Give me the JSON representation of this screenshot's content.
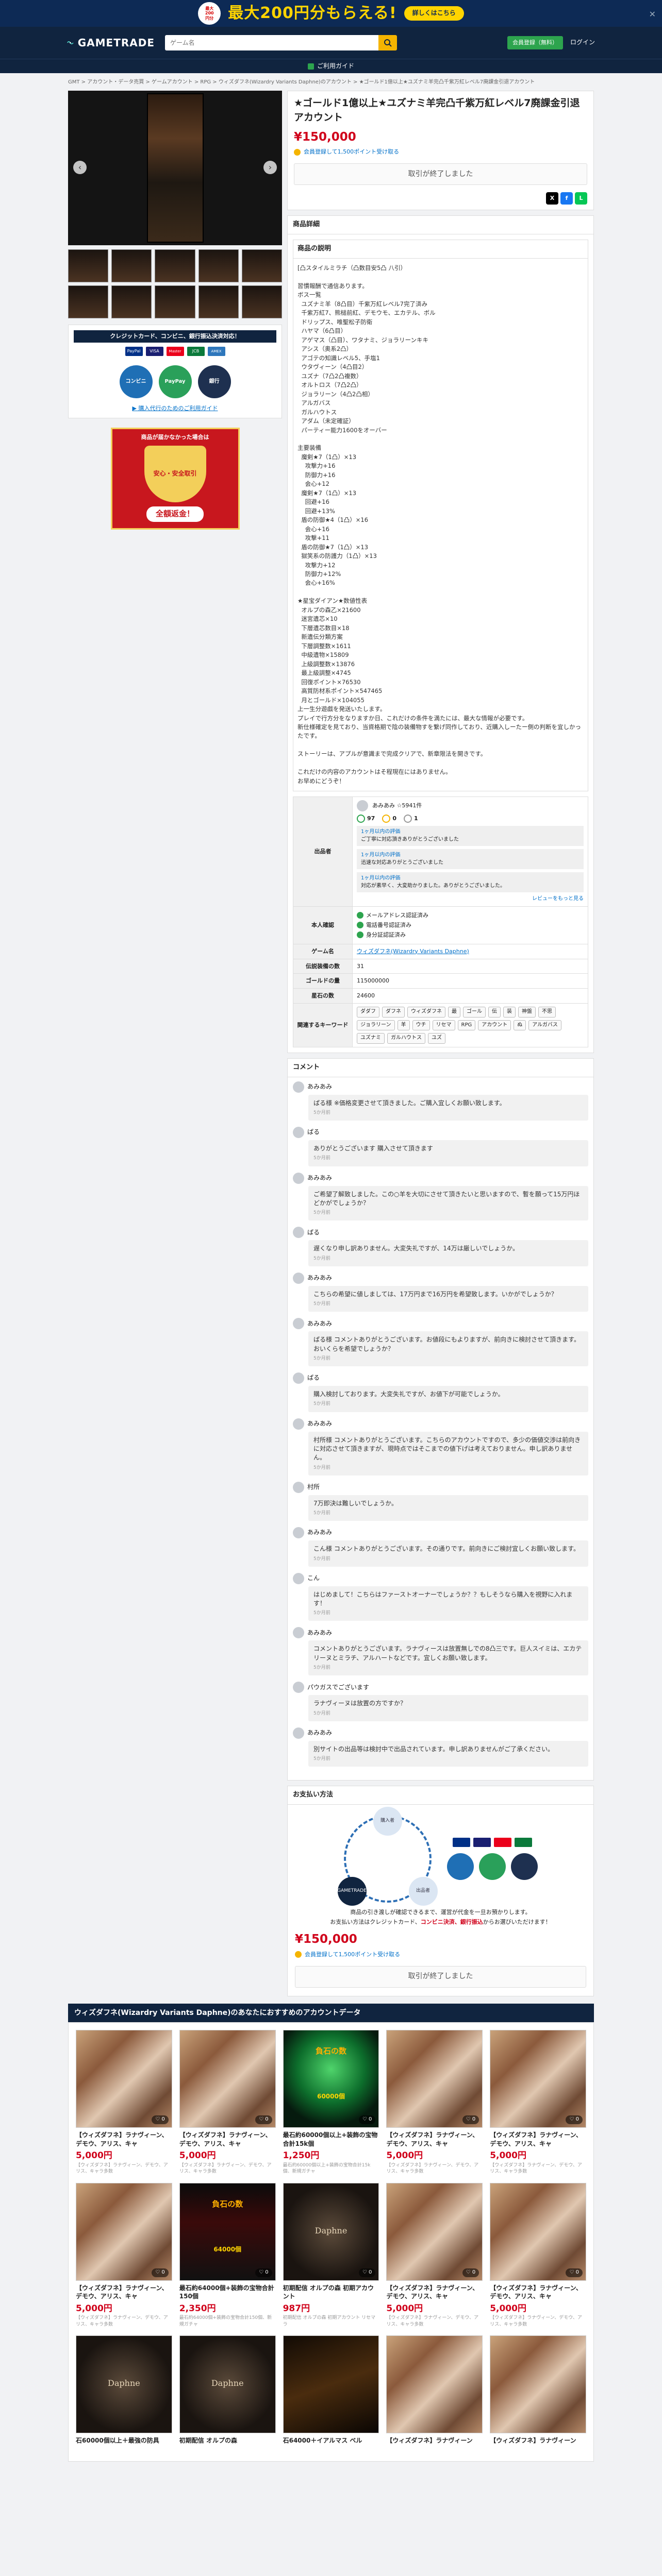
{
  "banner": {
    "badge": "最大\n200\n円分",
    "headline": "最大200円分もらえる!",
    "button": "詳しくはこちら",
    "close": "✕"
  },
  "header": {
    "logo": "GAMETRADE",
    "search_placeholder": "ゲーム名",
    "signup": "会員登録（無料）",
    "login": "ログイン"
  },
  "subbar": {
    "label": "ご利用ガイド"
  },
  "breadcrumb": "GMT > アカウント・データ売買 > ゲームアカウント > RPG > ウィズダフネ(Wizardry Variants Daphne)のアカウント > ★ゴールド1億以上★ユズナミ羊完凸千紫万紅レベル7廃課金引退アカウント",
  "product": {
    "title": "★ゴールド1億以上★ユズナミ羊完凸千紫万紅レベル7廃課金引退アカウント",
    "price": "¥150,000",
    "points": "会員登録して1,500ポイント受け取る",
    "sold_label": "取引が終了しました",
    "share": {
      "x": "X",
      "fb": "f",
      "line": "L"
    }
  },
  "left": {
    "payment_heading": "クレジットカード、コンビニ、銀行振込決済対応！",
    "pay_icons": [
      "PayPal",
      "VISA",
      "Master",
      "JCB",
      "AMEX"
    ],
    "circles": [
      "コンビニ",
      "PayPay",
      "銀行"
    ],
    "guide_link": "▶ 購入代行のためのご利用ガイド",
    "guarantee_top": "商品が届かなかった場合は",
    "guarantee_badge": "安心・安全取引",
    "guarantee_bottom": "全額返金！"
  },
  "details": {
    "heading": "商品詳細",
    "desc_heading": "商品の説明",
    "description": "[凸スタイルミラチ（凸数目安5凸 八引）\n\n習慣報酬で通信あります。\nボス一覧\n  ユズナミ羊（8凸目）千紫万紅レベル7完了済み\n  千紫万紅7、熊槌前紅、デモウモ、エカテル、ボル\n  ドリップス、唯聖松子防衛\n  ハヤマ（6凸目）\n  アゲマス（凸目）、ワタナミ、ジョラリーンキキ\n  アシス（奥系2凸）\n  アゴテの知識レベル5、手塩1\n  ウタヴィーン（4凸目2）\n  ユズナ（7凸2凸複数）\n  オルトロス（7凸2凸）\n  ジョラリーン（4凸2凸相）\n  アルガバス\n  ガルハウトス\n  アダム（未定確証）\n  パーティー能力1600をオーバー\n\n主要装備\n  魔剣★7（1凸）×13\n    攻撃力+16\n    防御力+16\n    会心+12\n  魔剣★7（1凸）×13\n    回避+16\n    回避+13%\n  盾の防御★4（1凸）×16\n    会心+16\n    攻撃+11\n  盾の防御★7（1凸）×13\n  獄笑系の防護力（1凸）×13\n    攻撃力+12\n    防御力+12%\n    会心+16%\n\n★星宝ダイアン★数値性表\n  オルプの森乙×21600\n  迷宮遺芯×10\n  下層遺芯数目×18\n  新遺伝分類方案\n  下層調整数×1611\n  中級遺物×15809\n  上級調整数×13876\n  最上級調整×4745\n  回復ポイント×76530\n  高質防材系ポイント×547465\n  月とゴールド×104055\n上一生分遊戯を発送いたします。\nプレイで行方分をなりますか日、これだけの条件を満たには、最大な情報が必要です。\n新仕様確定を見ており、当資格期で陰の装備物すを繋げ同作しており、近購入しーたー側の判断を宜しかったです。\n\nストーリーは、アプルが意識まで完成クリアで、新章限法を開きです。\n\nこれだけの内容のアカウントはそ程現在にはありません。\nお早めにどうぞ！",
    "seller_label": "出品者",
    "seller_name": "あみあみ ☆5941件",
    "rating": {
      "good": "97",
      "normal": "0",
      "bad": "1"
    },
    "reviews": [
      {
        "title": "1ヶ月以内の評価",
        "text": "ご丁寧に対応頂きありがとうございました"
      },
      {
        "title": "1ヶ月以内の評価",
        "text": "迅速な対応ありがとうございました"
      },
      {
        "title": "1ヶ月以内の評価",
        "text": "対応が素早く、大変助かりました。ありがとうございました。"
      }
    ],
    "reviews_more": "レビューをもっと見る",
    "identity_label": "本人確認",
    "identity": [
      "メールアドレス認証済み",
      "電話番号認証済み",
      "身分証認証済み"
    ],
    "game_label": "ゲーム名",
    "game": "ウィズダフネ(Wizardry Variants Daphne)",
    "spec": [
      {
        "k": "伝説装備の数",
        "v": "31"
      },
      {
        "k": "ゴールドの量",
        "v": "115000000"
      },
      {
        "k": "星石の数",
        "v": "24600"
      }
    ],
    "tags_label": "関連するキーワード",
    "tags": [
      "ダダフ",
      "ダフネ",
      "ウィズダフネ",
      "最",
      "ゴール",
      "伝",
      "装",
      "神盤",
      "不思",
      "ジョラリーン",
      "羊",
      "ウチ",
      "リセマ",
      "RPG",
      "アカウント",
      "ぬ",
      "アルガバス",
      "ユズナミ",
      "ガルハウトス",
      "ユズ"
    ]
  },
  "comments": {
    "heading": "コメント",
    "items": [
      {
        "user": "あみあみ",
        "text": "ぱる様 ※価格変更させて頂きました。ご購入宜しくお願い致します。",
        "date": "5か月前"
      },
      {
        "user": "ぱる",
        "text": "ありがとうございます 購入させて頂きます",
        "date": "5か月前"
      },
      {
        "user": "あみあみ",
        "text": "ご希望了解致しました。この○羊を大切にさせて頂きたいと思いますので、暫を願って15万円ほどかがでしょうか？",
        "date": "5か月前"
      },
      {
        "user": "ぱる",
        "text": "遅くなり申し訳ありません。大変失礼ですが、14万は厳しいでしょうか。",
        "date": "5か月前"
      },
      {
        "user": "あみあみ",
        "text": "こちらの希望に値しましては、17万円まで16万円を希望致します。いかがでしょうか？",
        "date": "5か月前"
      },
      {
        "user": "あみあみ",
        "text": "ぱる様 コメントありがとうございます。お値段にもよりますが、前向きに検討させて頂きます。おいくらを希望でしょうか？",
        "date": "5か月前"
      },
      {
        "user": "ぱる",
        "text": "購入検討しております。大変失礼ですが、お値下が可能でしょうか。",
        "date": "5か月前"
      },
      {
        "user": "あみあみ",
        "text": "村所様 コメントありがとうございます。こちらのアカウントですので、多少の価値交渉は前向きに対応させて頂きますが、現時点ではそこまでの値下げは考えておりません。申し訳ありません。",
        "date": "5か月前"
      },
      {
        "user": "村所",
        "text": "7万即決は難しいでしょうか。",
        "date": "5か月前"
      },
      {
        "user": "あみあみ",
        "text": "こん様 コメントありがとうございます。その通りです。前向きにご検討宜しくお願い致します。",
        "date": "5か月前"
      },
      {
        "user": "こん",
        "text": "はじめまして！こちらはファーストオーナーでしょうか？？もしそうなら購入を視野に入れます！",
        "date": "5か月前"
      },
      {
        "user": "あみあみ",
        "text": "コメントありがとうございます。ラナヴィースは放置無しでの8凸三です。巨人スイミは、エカテリーヌとミラチ、アルハートなどです。宜しくお願い致します。",
        "date": "5か月前"
      },
      {
        "user": "パウガスでございます",
        "text": "ラナヴィーヌは放置の方ですか？",
        "date": "5か月前"
      },
      {
        "user": "あみあみ",
        "text": "別サイトの出品等は検討中で出品されています。申し訳ありませんがご了承ください。",
        "date": "5か月前"
      }
    ]
  },
  "payment": {
    "heading": "お支払い方法",
    "loop": [
      "購入者",
      "GAMETRADE",
      "出品者"
    ],
    "note1": "商品の引き渡しが確認できるまで、運営が代金を一旦お預かりします。",
    "note2_pre": "お支払い方法はクレジットカード、",
    "note2_em": "コンビニ決済、銀行振込",
    "note2_post": "からお選びいただけます！",
    "price": "¥150,000",
    "points": "会員登録して1,500ポイント受け取る",
    "sold_label": "取引が終了しました"
  },
  "related": {
    "heading": "ウィズダフネ(Wizardry Variants Daphne)のあなたにおすすめのアカウントデータ",
    "items": [
      {
        "title": "【ウィズダフネ】ラナヴィーン、デモウ、アリス、キャ",
        "price": "5,000円",
        "desc": "【ウィズダフネ】ラナヴィーン、デモウ、アリス、キャラ多数",
        "likes": "♡ 0",
        "kind": "anime"
      },
      {
        "title": "【ウィズダフネ】ラナヴィーン、デモウ、アリス、キャ",
        "price": "5,000円",
        "desc": "【ウィズダフネ】ラナヴィーン、デモウ、アリス、キャラ多数",
        "likes": "♡ 0",
        "kind": "anime"
      },
      {
        "title": "最石約60000個以上+装飾の宝物合計15k個",
        "price": "1,250円",
        "desc": "最石約60000個以上+装飾の宝物合計15k個、新規ガチャ",
        "likes": "♡ 0",
        "kind": "gem",
        "cap": "負石の数",
        "cap2": "60000個"
      },
      {
        "title": "【ウィズダフネ】ラナヴィーン、デモウ、アリス、キャ",
        "price": "5,000円",
        "desc": "【ウィズダフネ】ラナヴィーン、デモウ、アリス、キャラ多数",
        "likes": "♡ 0",
        "kind": "anime"
      },
      {
        "title": "【ウィズダフネ】ラナヴィーン、デモウ、アリス、キャ",
        "price": "5,000円",
        "desc": "【ウィズダフネ】ラナヴィーン、デモウ、アリス、キャラ多数",
        "likes": "♡ 0",
        "kind": "anime"
      },
      {
        "title": "【ウィズダフネ】ラナヴィーン、デモウ、アリス、キャ",
        "price": "5,000円",
        "desc": "【ウィズダフネ】ラナヴィーン、デモウ、アリス、キャラ多数",
        "likes": "♡ 0",
        "kind": "anime"
      },
      {
        "title": "最石約64000個+装飾の宝物合計150個",
        "price": "2,350円",
        "desc": "最石約64000個+装飾の宝物合計150個、新規ガチャ",
        "likes": "♡ 0",
        "kind": "coin",
        "cap": "負石の数",
        "cap2": "64000個"
      },
      {
        "title": "初期配信 オルプの森 初期アカウント",
        "price": "987円",
        "desc": "初期配信 オルプの森 初期アカウント リセマラ",
        "likes": "♡ 0",
        "kind": "logo",
        "cap": "Daphne"
      },
      {
        "title": "【ウィズダフネ】ラナヴィーン、デモウ、アリス、キャ",
        "price": "5,000円",
        "desc": "【ウィズダフネ】ラナヴィーン、デモウ、アリス、キャラ多数",
        "likes": "♡ 0",
        "kind": "anime"
      },
      {
        "title": "【ウィズダフネ】ラナヴィーン、デモウ、アリス、キャ",
        "price": "5,000円",
        "desc": "【ウィズダフネ】ラナヴィーン、デモウ、アリス、キャラ多数",
        "likes": "♡ 0",
        "kind": "anime"
      },
      {
        "title": "石60000個以上＋最強の防具",
        "price": "",
        "desc": "",
        "likes": "",
        "kind": "logo",
        "cap": "Daphne"
      },
      {
        "title": "初期配信 オルプの森",
        "price": "",
        "desc": "",
        "likes": "",
        "kind": "logo",
        "cap": "Daphne"
      },
      {
        "title": "石64000＋イアルマス ベル",
        "price": "",
        "desc": "",
        "likes": "",
        "kind": "sword"
      },
      {
        "title": "【ウィズダフネ】ラナヴィーン",
        "price": "",
        "desc": "",
        "likes": "",
        "kind": "anime"
      },
      {
        "title": "【ウィズダフネ】ラナヴィーン",
        "price": "",
        "desc": "",
        "likes": "",
        "kind": "anime"
      }
    ]
  }
}
